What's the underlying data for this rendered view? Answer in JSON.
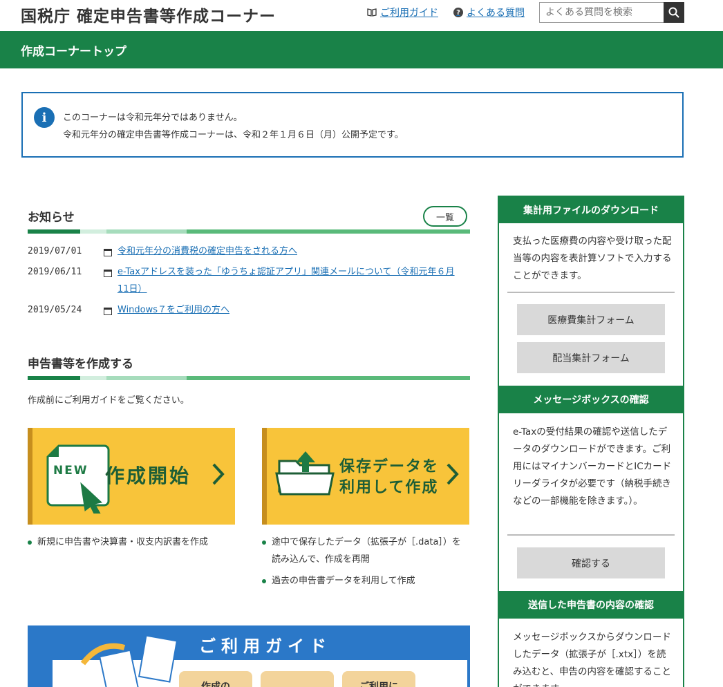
{
  "header": {
    "title": "国税庁 確定申告書等作成コーナー",
    "guide_link": "ご利用ガイド",
    "faq_link": "よくある質問",
    "search_placeholder": "よくある質問を検索"
  },
  "nav": {
    "title": "作成コーナートップ"
  },
  "notice": {
    "line1": "このコーナーは令和元年分ではありません。",
    "line2": "令和元年分の確定申告書等作成コーナーは、令和２年１月６日（月）公開予定です。"
  },
  "news": {
    "heading": "お知らせ",
    "list_button": "一覧",
    "items": [
      {
        "date": "2019/07/01",
        "text": "令和元年分の消費税の確定申告をされる方へ"
      },
      {
        "date": "2019/06/11",
        "text": "e-Taxアドレスを装った「ゆうちょ認証アプリ」関連メールについて（令和元年６月11日）"
      },
      {
        "date": "2019/05/24",
        "text": "Windows７をご利用の方へ"
      }
    ]
  },
  "create": {
    "heading": "申告書等を作成する",
    "note": "作成前にご利用ガイドをご覧ください。",
    "card1": {
      "badge": "NEW",
      "title": "作成開始"
    },
    "card2": {
      "title_line1": "保存データを",
      "title_line2": "利用して作成"
    },
    "bullets1": [
      "新規に申告書や決算書・収支内訳書を作成"
    ],
    "bullets2": [
      "途中で保存したデータ（拡張子が［.data］）を読み込んで、作成を再開",
      "過去の申告書データを利用して作成"
    ]
  },
  "guide_banner": {
    "title": "ご利用ガイド",
    "tab1": "作成の",
    "tab2": "",
    "tab3": "ご利用に"
  },
  "sidebar": {
    "s1": {
      "heading": "集計用ファイルのダウンロード",
      "text": "支払った医療費の内容や受け取った配当等の内容を表計算ソフトで入力することができます。",
      "btn1": "医療費集計フォーム",
      "btn2": "配当集計フォーム"
    },
    "s2": {
      "heading": "メッセージボックスの確認",
      "text": "e-Taxの受付結果の確認や送信したデータのダウンロードができます。ご利用にはマイナンバーカードとICカードリーダライタが必要です（納税手続きなどの一部機能を除きます。）。",
      "btn": "確認する"
    },
    "s3": {
      "heading": "送信した申告書の内容の確認",
      "text": "メッセージボックスからダウンロードしたデータ（拡張子が［.xtx］）を読み込むと、申告の内容を確認することができます。"
    }
  },
  "colors": {
    "brand_green": "#198248",
    "info_blue": "#1a6fb4",
    "card_yellow": "#f8c43a"
  }
}
